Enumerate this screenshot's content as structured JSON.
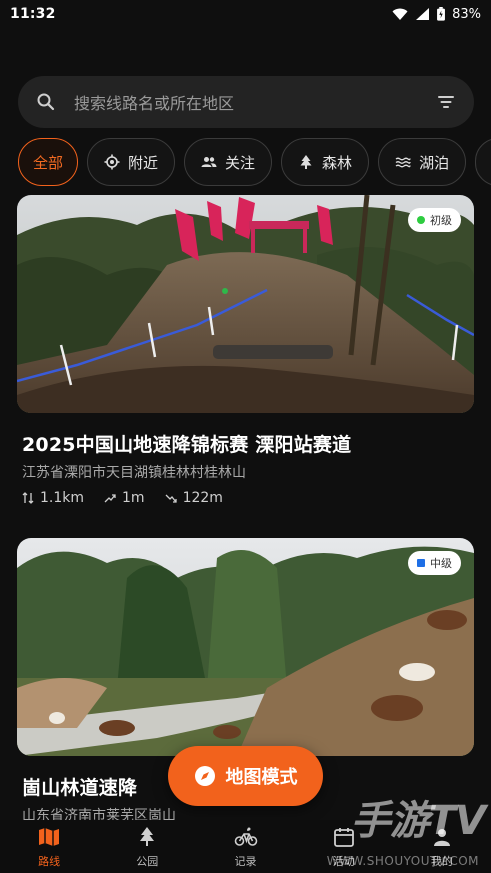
{
  "status_bar": {
    "time": "11:32",
    "battery": "83%"
  },
  "search": {
    "placeholder": "搜索线路名或所在地区"
  },
  "chips": [
    {
      "label": "全部",
      "icon": "none",
      "active": true
    },
    {
      "label": "附近",
      "icon": "locate-icon"
    },
    {
      "label": "关注",
      "icon": "people-icon"
    },
    {
      "label": "森林",
      "icon": "tree-icon"
    },
    {
      "label": "湖泊",
      "icon": "waves-icon"
    }
  ],
  "cards": [
    {
      "title": "2025中国山地速降锦标赛 溧阳站赛道",
      "location": "江苏省溧阳市天目湖镇桂林村桂林山",
      "difficulty": "初级",
      "difficulty_color": "#2ecc40",
      "distance": "1.1km",
      "ascent": "1m",
      "descent": "122m"
    },
    {
      "title": "崮山林道速降",
      "location": "山东省济南市莱芜区崮山",
      "difficulty": "中级",
      "difficulty_color": "#1e6fe6"
    }
  ],
  "map_button": {
    "label": "地图模式"
  },
  "nav": [
    {
      "label": "路线",
      "icon": "map-icon",
      "active": true
    },
    {
      "label": "公园",
      "icon": "tree-icon"
    },
    {
      "label": "记录",
      "icon": "bike-icon"
    },
    {
      "label": "活动",
      "icon": "calendar-icon"
    },
    {
      "label": "我的",
      "icon": "person-icon"
    }
  ],
  "watermark": {
    "main": "手游TV",
    "sub": "WWW.SHOUYOUTV.COM"
  },
  "colors": {
    "accent": "#f2621c",
    "background": "#0f0f0f",
    "surface": "#232323"
  }
}
